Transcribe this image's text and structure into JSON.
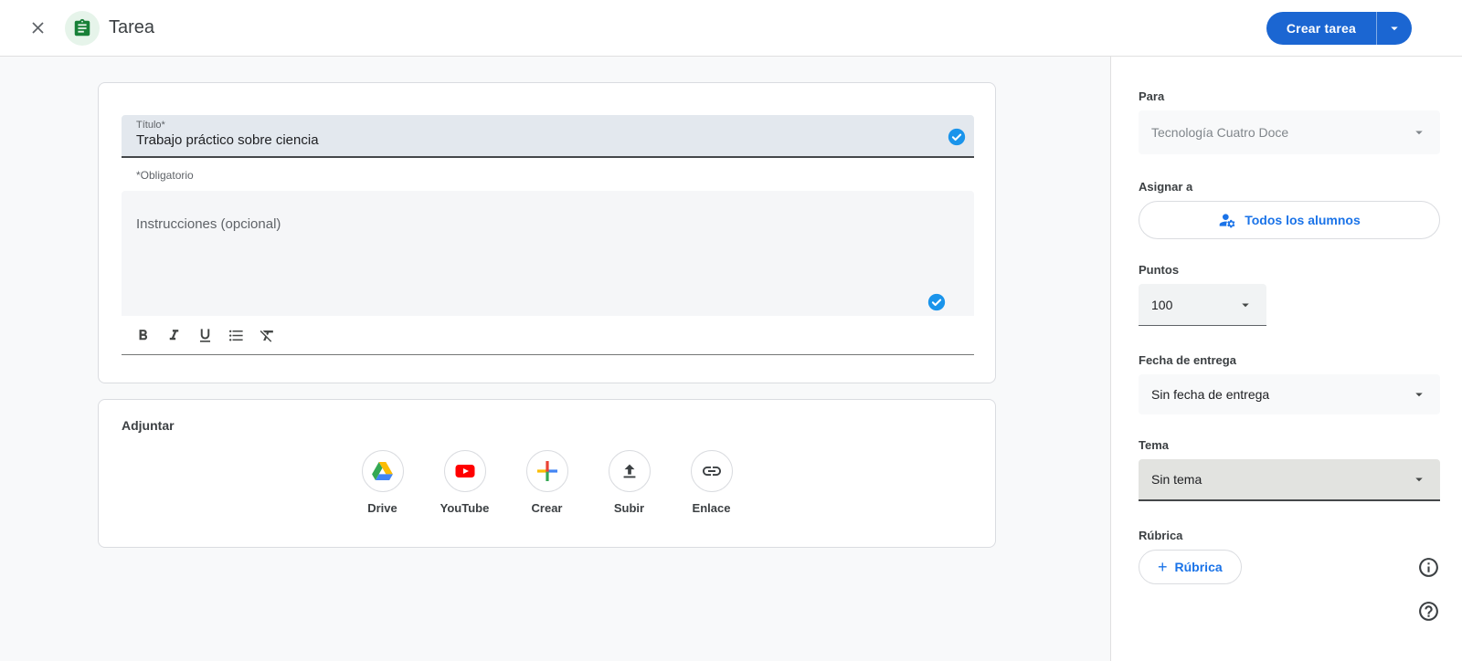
{
  "header": {
    "title": "Tarea",
    "create_button_label": "Crear tarea",
    "icons": [
      "close-icon",
      "assignment-icon",
      "dropdown-arrow-icon"
    ]
  },
  "editor": {
    "title_label": "Título*",
    "title_value": "Trabajo práctico sobre ciencia",
    "required_note": "*Obligatorio",
    "instructions_placeholder": "Instrucciones (opcional)",
    "toolbar_icons": [
      "bold-icon",
      "italic-icon",
      "underline-icon",
      "bulleted-list-icon",
      "clear-formatting-icon"
    ],
    "status_icon": "check-circle-icon"
  },
  "attachments": {
    "section_label": "Adjuntar",
    "options": [
      {
        "icon": "drive-icon",
        "label": "Drive"
      },
      {
        "icon": "youtube-icon",
        "label": "YouTube"
      },
      {
        "icon": "create-icon",
        "label": "Crear"
      },
      {
        "icon": "upload-icon",
        "label": "Subir"
      },
      {
        "icon": "link-icon",
        "label": "Enlace"
      }
    ]
  },
  "sidebar": {
    "para": {
      "label": "Para",
      "value": "Tecnología Cuatro Doce"
    },
    "assign": {
      "label": "Asignar a",
      "button_label": "Todos los alumnos",
      "icon": "manage-accounts-icon"
    },
    "points": {
      "label": "Puntos",
      "value": "100"
    },
    "due_date": {
      "label": "Fecha de entrega",
      "value": "Sin fecha de entrega"
    },
    "topic": {
      "label": "Tema",
      "value": "Sin tema"
    },
    "rubric": {
      "label": "Rúbrica",
      "button_label": "Rúbrica",
      "button_plus": "+"
    },
    "corner_icons": [
      "info-icon",
      "help-icon"
    ]
  },
  "colors": {
    "primary_button_blue": "#1b66d2",
    "link_blue": "#1a73e8",
    "check_blue": "#1a94eb",
    "assignment_green": "#188038",
    "main_background": "#f8f9fa"
  }
}
